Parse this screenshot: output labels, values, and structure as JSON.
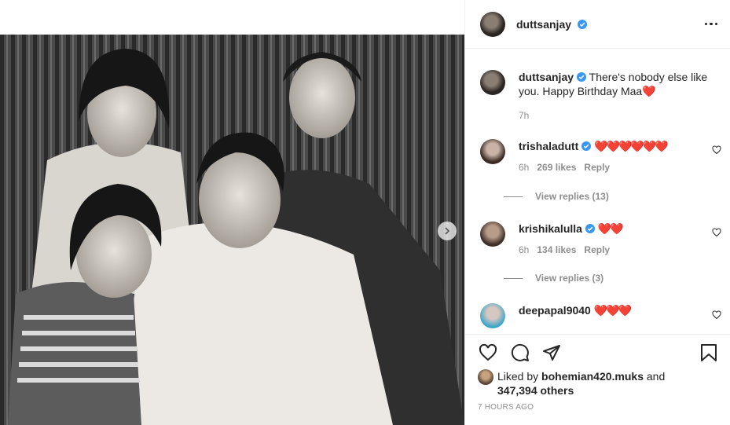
{
  "post": {
    "author": "duttsanjay",
    "caption": "There's nobody else like you. Happy Birthday Maa",
    "caption_emoji": "❤️",
    "caption_time": "7h"
  },
  "comments": [
    {
      "user": "trishaladutt",
      "verified": true,
      "text": "❤️❤️❤️❤️❤️❤️",
      "time": "6h",
      "likes": "269 likes",
      "reply": "Reply",
      "view_replies": "View replies (13)"
    },
    {
      "user": "krishikalulla",
      "verified": true,
      "text": "❤️❤️",
      "time": "6h",
      "likes": "134 likes",
      "reply": "Reply",
      "view_replies": "View replies (3)"
    },
    {
      "user": "deepapal9040",
      "verified": false,
      "text": "❤️❤️❤️"
    }
  ],
  "likes": {
    "prefix": "Liked by",
    "user": "bohemian420.muks",
    "and": "and",
    "count": "347,394 others"
  },
  "timestamp": "7 HOURS AGO",
  "colors": {
    "verified": "#3897f0",
    "heart": "#ed4956",
    "muted": "#8e8e8e"
  }
}
